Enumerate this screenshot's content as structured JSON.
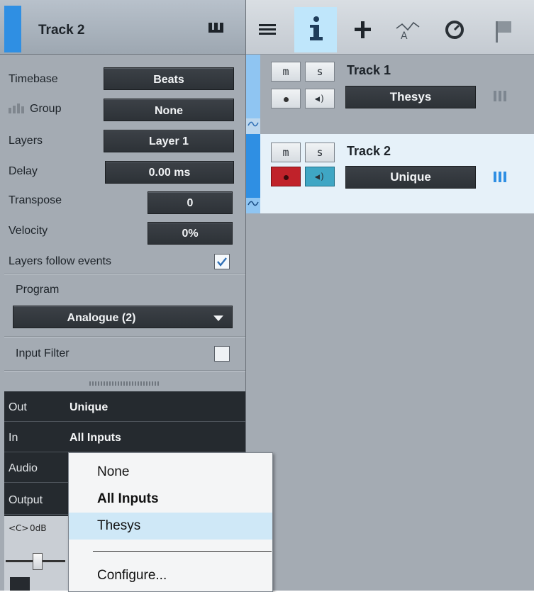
{
  "inspector": {
    "track_title": "Track 2",
    "rows": {
      "timebase": {
        "label": "Timebase",
        "value": "Beats"
      },
      "group": {
        "label": "Group",
        "value": "None"
      },
      "layers": {
        "label": "Layers",
        "value": "Layer 1"
      },
      "delay": {
        "label": "Delay",
        "value": "0.00 ms"
      },
      "transpose": {
        "label": "Transpose",
        "value": "0"
      },
      "velocity": {
        "label": "Velocity",
        "value": "0%"
      }
    },
    "layers_follow": {
      "label": "Layers follow events",
      "checked": true
    },
    "program": {
      "label": "Program",
      "value": "Analogue (2)"
    },
    "input_filter": {
      "label": "Input Filter",
      "checked": false
    },
    "dark": {
      "out": {
        "key": "Out",
        "value": "Unique"
      },
      "in": {
        "key": "In",
        "value": "All Inputs"
      },
      "audio": {
        "key": "Audio"
      },
      "output": {
        "key": "Output"
      },
      "pan_label": "<C>",
      "vol_label": "0dB"
    }
  },
  "toolbar": {
    "icons": [
      "list-icon",
      "info-icon",
      "add-icon",
      "automation-icon",
      "clock-icon",
      "flag-icon"
    ],
    "active": "info-icon"
  },
  "tracks": [
    {
      "mute": "m",
      "solo": "s",
      "name": "Track 1",
      "instrument": "Thesys",
      "armed": false
    },
    {
      "mute": "m",
      "solo": "s",
      "name": "Track 2",
      "instrument": "Unique",
      "armed": true
    }
  ],
  "menu": {
    "items": [
      {
        "label": "None",
        "bold": false
      },
      {
        "label": "All Inputs",
        "bold": true
      },
      {
        "label": "Thesys",
        "bold": false,
        "highlighted": true
      },
      {
        "label": "Configure...",
        "bold": false
      }
    ]
  },
  "colors": {
    "accent": "#2f8fe3",
    "panel": "#a4abb3",
    "button_dark": "#2d3237",
    "selection": "#cfe8f7",
    "record_red": "#c0222a",
    "monitor_teal": "#3fa6c4"
  }
}
